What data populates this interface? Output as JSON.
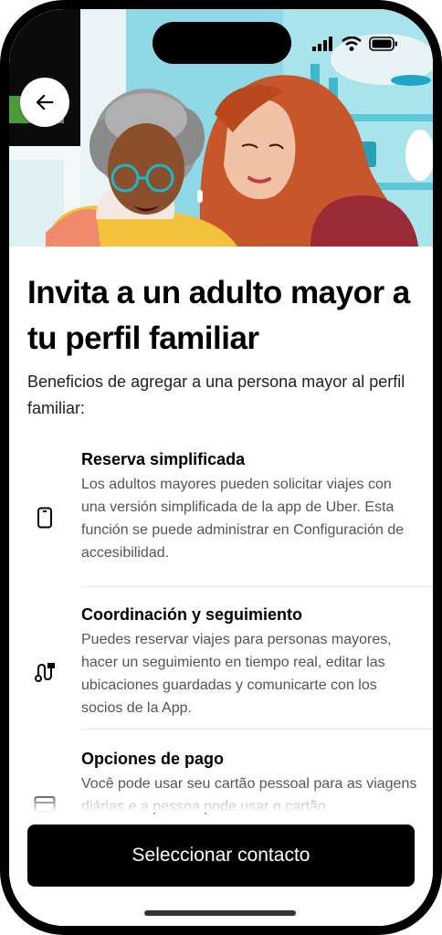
{
  "header": {
    "back_icon": "arrow-left-icon",
    "illustration": "two-women-hugging-illustration"
  },
  "status_bar": {
    "icons": [
      "cellular-signal-icon",
      "wifi-icon",
      "battery-icon"
    ]
  },
  "main": {
    "title": "Invita a un adulto mayor a tu perfil familiar",
    "intro": "Beneficios de agregar a una persona mayor al perfil familiar:",
    "benefits": [
      {
        "icon": "phone-icon",
        "title": "Reserva simplificada",
        "description": "Los adultos mayores pueden solicitar viajes con una versión simplificada de la app de Uber. Esta función se puede administrar en Configuración de accesibilidad."
      },
      {
        "icon": "route-icon",
        "title": "Coordinación y seguimiento",
        "description": "Puedes reservar viajes para personas mayores, hacer un seguimiento en tiempo real, editar las ubicaciones guardadas y comunicarte con los socios de la App."
      },
      {
        "icon": "credit-card-icon",
        "title": "Opciones de pago",
        "description": "Você pode usar seu cartão pessoal para as viagens diárias e a pessoa pode usar o cartão"
      }
    ]
  },
  "footer": {
    "cta_label": "Seleccionar contacto"
  },
  "colors": {
    "primary": "#000000",
    "secondary_text": "#545454",
    "divider": "#e8e8e8",
    "hero_sky": "#7fd3e0"
  }
}
